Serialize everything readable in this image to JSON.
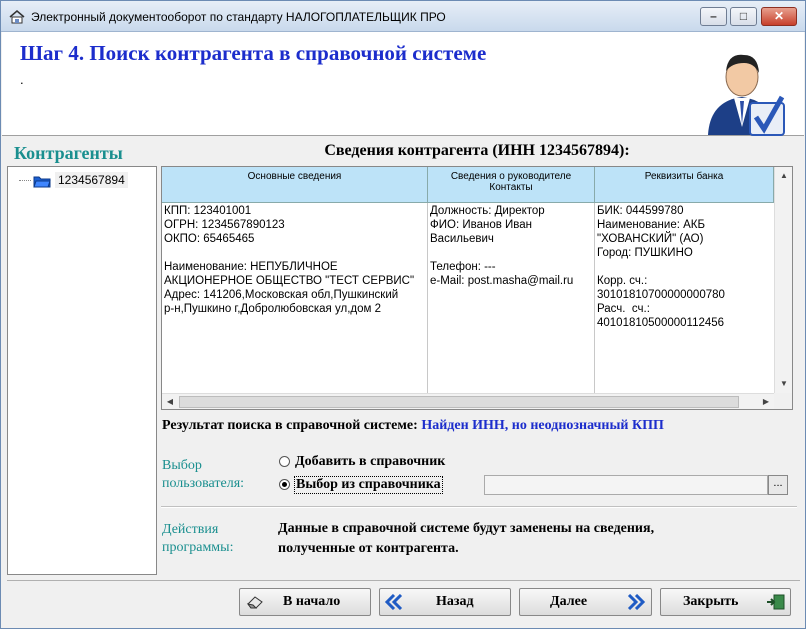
{
  "window": {
    "title": "Электронный документооборот по стандарту НАЛОГОПЛАТЕЛЬЩИК ПРО"
  },
  "header": {
    "step_title": "Шаг 4. Поиск контрагента в справочной системе",
    "subtitle": "."
  },
  "sidebar": {
    "title": "Контрагенты",
    "items": [
      {
        "label": "1234567894"
      }
    ]
  },
  "details": {
    "title": "Сведения контрагента (ИНН 1234567894):",
    "columns": [
      {
        "header": "Основные сведения",
        "lines": "КПП: 123401001\nОГРН: 1234567890123\nОКПО: 65465465\n\nНаименование: НЕПУБЛИЧНОЕ\nАКЦИОНЕРНОЕ ОБЩЕСТВО \"ТЕСТ СЕРВИС\"\nАдрес: 141206,Московская обл,Пушкинский\nр-н,Пушкино г,Добролюбовская ул,дом 2"
      },
      {
        "header": "Сведения о руководителе\nКонтакты",
        "lines": "Должность: Директор\nФИО: Иванов Иван\nВасильевич\n\nТелефон: ---\ne-Mail: post.masha@mail.ru"
      },
      {
        "header": "Реквизиты банка",
        "lines": "БИК: 044599780\nНаименование: АКБ\n\"ХОВАНСКИЙ\" (АО)\nГород: ПУШКИНО\n\nКорр. сч.:\n30101810700000000780\nРасч.  сч.:\n40101810500000112456"
      }
    ]
  },
  "result": {
    "label": "Результат поиска в справочной системе:",
    "value": "Найден ИНН, но неоднозначный КПП"
  },
  "choice": {
    "label_line1": "Выбор",
    "label_line2": "пользователя:",
    "option_add": "Добавить в справочник",
    "option_pick": "Выбор из справочника",
    "selected": "option_pick",
    "combo_value": "",
    "combo_button": "..."
  },
  "action": {
    "label_line1": "Действия",
    "label_line2": "программы:",
    "text_line1": "Данные в справочной системе будут заменены на сведения,",
    "text_line2": "полученные от контрагента."
  },
  "buttons": {
    "home": "В начало",
    "back": "Назад",
    "next": "Далее",
    "close": "Закрыть"
  }
}
